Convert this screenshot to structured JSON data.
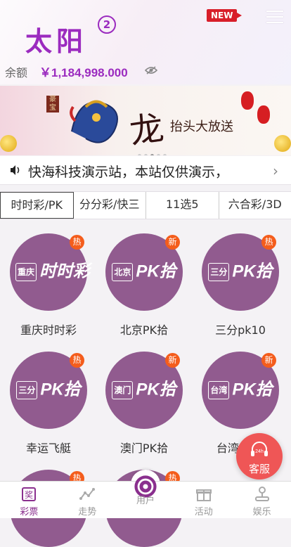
{
  "header": {
    "logo": "太阳",
    "logo_badge": "2",
    "new_badge": "NEW",
    "balance_label": "余额",
    "balance_value": "￥1,184,998.000"
  },
  "banner": {
    "stamp": "豪宝",
    "calligraphy_big": "龙",
    "calligraphy_small": "抬头大放送"
  },
  "notice": {
    "text": "快海科技演示站，本站仅供演示，"
  },
  "tabs": [
    {
      "label": "时时彩/PK"
    },
    {
      "label": "分分彩/快三"
    },
    {
      "label": "11选5"
    },
    {
      "label": "六合彩/3D"
    }
  ],
  "games": [
    {
      "name": "重庆时时彩",
      "badge": "热",
      "icon_prefix": "重庆",
      "icon_text": "时时彩"
    },
    {
      "name": "北京PK拾",
      "badge": "新",
      "icon_prefix": "北京",
      "icon_text": "PK拾"
    },
    {
      "name": "三分pk10",
      "badge": "热",
      "icon_prefix": "三分",
      "icon_text": "PK拾"
    },
    {
      "name": "幸运飞艇",
      "badge": "热",
      "icon_prefix": "三分",
      "icon_text": "PK拾"
    },
    {
      "name": "澳门PK拾",
      "badge": "新",
      "icon_prefix": "澳门",
      "icon_text": "PK拾"
    },
    {
      "name": "台湾PK拾",
      "badge": "新",
      "icon_prefix": "台湾",
      "icon_text": "PK拾"
    },
    {
      "badge": "热"
    },
    {
      "badge": "热"
    }
  ],
  "service": {
    "badge": "24h",
    "label": "客服"
  },
  "bottom_nav": [
    {
      "label": "彩票"
    },
    {
      "label": "走势"
    },
    {
      "label": "用户"
    },
    {
      "label": "活动"
    },
    {
      "label": "娱乐"
    }
  ]
}
